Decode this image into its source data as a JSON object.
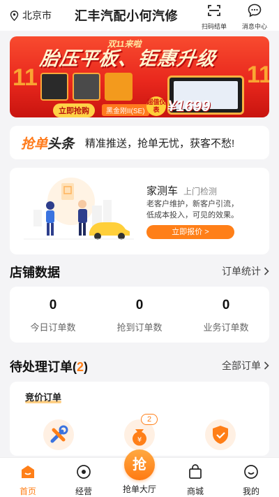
{
  "header": {
    "location": "北京市",
    "shop_title": "汇丰汽配小何汽修",
    "scan_label": "扫码结单",
    "msg_label": "消息中心"
  },
  "banner": {
    "tag": "双11来啦",
    "title": "胎压平板、钜惠升级",
    "buy_label": "立即抢购",
    "model_label": "黑金刚II(SE)",
    "promo_label": "超值仪表",
    "price": "¥1699"
  },
  "headline": {
    "logo_a": "抢单",
    "logo_b": "头条",
    "text": "精准推送，抢单无忧，获客不愁!"
  },
  "home_service": {
    "title": "家测车",
    "subtitle": "上门检测",
    "line1": "老客户维护，新客户引流，",
    "line2": "低成本投入，可见的效果。",
    "button": "立即报价 >"
  },
  "store_data": {
    "title": "店铺数据",
    "link": "订单统计",
    "stats": [
      {
        "num": "0",
        "label": "今日订单数"
      },
      {
        "num": "0",
        "label": "抢到订单数"
      },
      {
        "num": "0",
        "label": "业务订单数"
      }
    ]
  },
  "pending": {
    "title": "待处理订单(",
    "count": "2",
    "title_end": ")",
    "link": "全部订单",
    "bid_title": "竞价订单",
    "badge": "2"
  },
  "tabbar": {
    "tabs": [
      {
        "label": "首页"
      },
      {
        "label": "经营"
      },
      {
        "label": "抢单大厅",
        "glyph": "抢"
      },
      {
        "label": "商城"
      },
      {
        "label": "我的"
      }
    ]
  },
  "colors": {
    "accent": "#ff7f18",
    "banner_red": "#e9281d"
  }
}
